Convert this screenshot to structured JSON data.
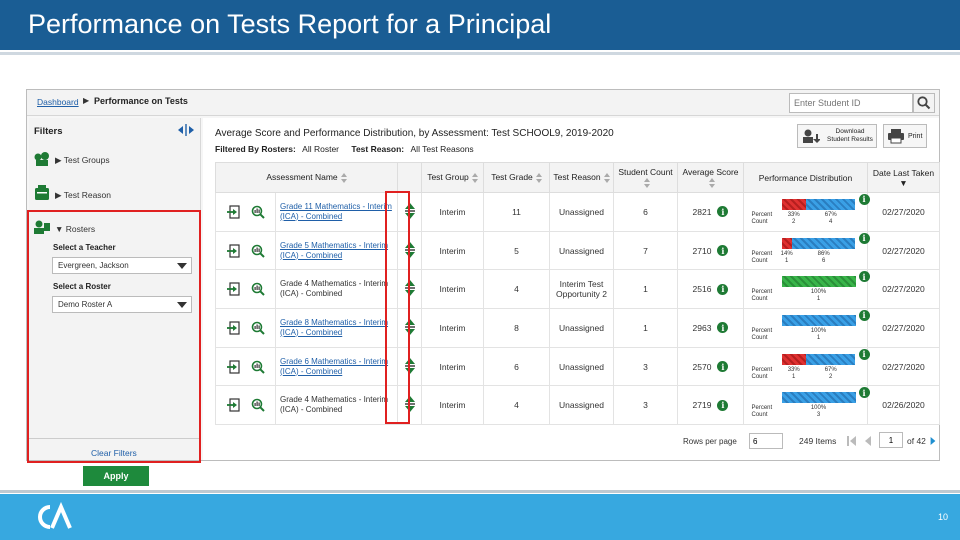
{
  "slide": {
    "title": "Performance on Tests Report for a Principal",
    "page_number": "10"
  },
  "breadcrumb": {
    "dashboard": "Dashboard",
    "current": "Performance on Tests"
  },
  "student_search": {
    "placeholder": "Enter Student ID"
  },
  "filters": {
    "title": "Filters",
    "test_groups": "Test Groups",
    "test_reason": "Test Reason",
    "rosters": "Rosters",
    "select_teacher_label": "Select a Teacher",
    "teacher_value": "Evergreen, Jackson",
    "select_roster_label": "Select a Roster",
    "roster_value": "Demo Roster A",
    "clear_filters": "Clear Filters",
    "apply": "Apply"
  },
  "report": {
    "title": "Average Score and Performance Distribution, by Assessment: Test SCHOOL9, 2019-2020",
    "filtered_by_label": "Filtered By",
    "rosters_key": "Rosters:",
    "rosters_val": "All Roster",
    "reason_key": "Test Reason:",
    "reason_val": "All Test Reasons",
    "download_label": "Download Student Results",
    "print_label": "Print"
  },
  "table": {
    "headers": {
      "assessment_name": "Assessment Name",
      "test_group": "Test Group",
      "test_grade": "Test Grade",
      "test_reason": "Test Reason",
      "student_count": "Student Count",
      "average_score": "Average Score",
      "performance_distribution": "Performance Distribution",
      "date_last_taken": "Date Last Taken"
    },
    "percent_label": "Percent",
    "count_label": "Count",
    "rows": [
      {
        "name": "Grade 11 Mathematics - Interim (ICA) - Combined",
        "group": "Interim",
        "grade": "11",
        "reason": "Unassigned",
        "count": "6",
        "score": "2821",
        "date": "02/27/2020",
        "linked": true,
        "dist": [
          {
            "color": "red",
            "percent": "33%",
            "count": "2",
            "fraction": 0.33
          },
          {
            "color": "blue",
            "percent": "67%",
            "count": "4",
            "fraction": 0.67
          }
        ]
      },
      {
        "name": "Grade 5 Mathematics - Interim (ICA) - Combined",
        "group": "Interim",
        "grade": "5",
        "reason": "Unassigned",
        "count": "7",
        "score": "2710",
        "date": "02/27/2020",
        "linked": true,
        "dist": [
          {
            "color": "red",
            "percent": "14%",
            "count": "1",
            "fraction": 0.14
          },
          {
            "color": "blue",
            "percent": "86%",
            "count": "6",
            "fraction": 0.86
          }
        ]
      },
      {
        "name": "Grade 4 Mathematics - Interim (ICA) - Combined",
        "group": "Interim",
        "grade": "4",
        "reason": "Interim Test Opportunity 2",
        "count": "1",
        "score": "2516",
        "date": "02/27/2020",
        "linked": false,
        "dist": [
          {
            "color": "green",
            "percent": "100%",
            "count": "1",
            "fraction": 1.0
          }
        ]
      },
      {
        "name": "Grade 8 Mathematics - Interim (ICA) - Combined",
        "group": "Interim",
        "grade": "8",
        "reason": "Unassigned",
        "count": "1",
        "score": "2963",
        "date": "02/27/2020",
        "linked": true,
        "dist": [
          {
            "color": "blue",
            "percent": "100%",
            "count": "1",
            "fraction": 1.0
          }
        ]
      },
      {
        "name": "Grade 6 Mathematics - Interim (ICA) - Combined",
        "group": "Interim",
        "grade": "6",
        "reason": "Unassigned",
        "count": "3",
        "score": "2570",
        "date": "02/27/2020",
        "linked": true,
        "dist": [
          {
            "color": "red",
            "percent": "33%",
            "count": "1",
            "fraction": 0.33
          },
          {
            "color": "blue",
            "percent": "67%",
            "count": "2",
            "fraction": 0.67
          }
        ]
      },
      {
        "name": "Grade 4 Mathematics - Interim (ICA) - Combined",
        "group": "Interim",
        "grade": "4",
        "reason": "Unassigned",
        "count": "3",
        "score": "2719",
        "date": "02/26/2020",
        "linked": false,
        "dist": [
          {
            "color": "blue",
            "percent": "100%",
            "count": "3",
            "fraction": 1.0
          }
        ]
      }
    ]
  },
  "pager": {
    "rows_per_page_label": "Rows per page",
    "rows_per_page": "6",
    "items": "249 Items",
    "page": "1",
    "of_pages": "of 42"
  },
  "colors": {
    "header_bg": "#1a5d94",
    "footer_bg": "#37a8e0",
    "highlight": "#e02020",
    "apply": "#1e8a3c",
    "link": "#1f5fa8"
  }
}
